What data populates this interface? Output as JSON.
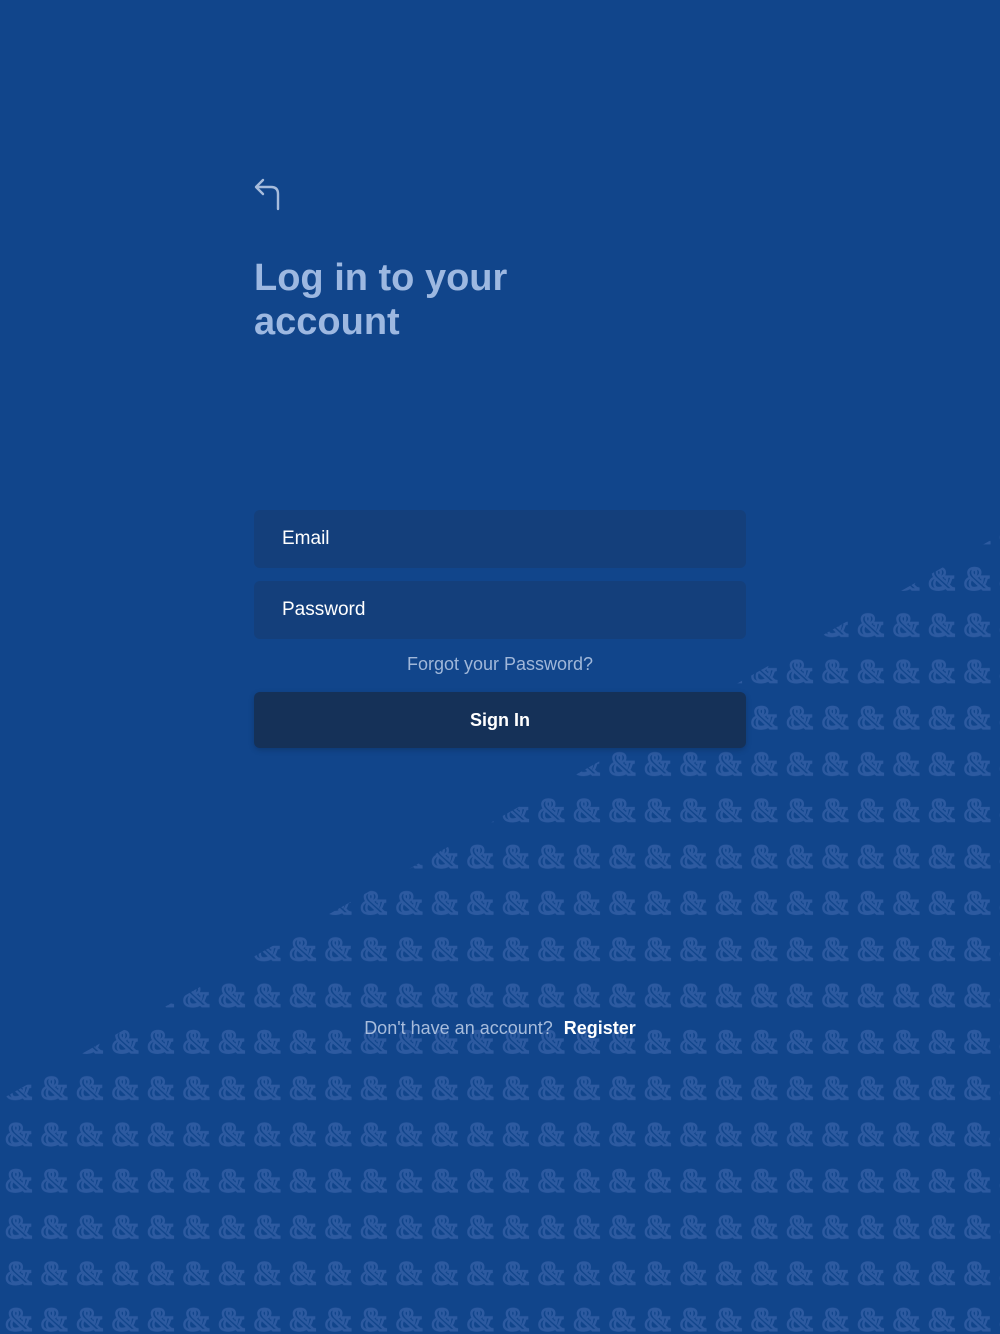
{
  "background": {
    "color": "#11458b",
    "pattern_symbol": "&",
    "pattern_color": "#2d5aa0"
  },
  "header": {
    "back_icon": "back-arrow-icon",
    "title": "Log in to your account"
  },
  "form": {
    "email_placeholder": "Email",
    "password_placeholder": "Password",
    "forgot_password": "Forgot your Password?",
    "sign_in": "Sign In"
  },
  "footer": {
    "register_prompt": "Don't have an account?",
    "register_link": "Register"
  },
  "colors": {
    "title": "#9db8e1",
    "field_background": "#143f7b",
    "button_background": "#153158",
    "link": "#a0b7d9",
    "text": "#ffffff"
  }
}
